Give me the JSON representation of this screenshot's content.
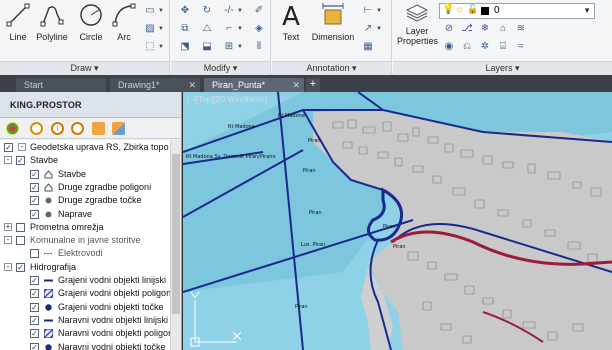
{
  "ribbon": {
    "draw": {
      "title": "Draw",
      "tools": [
        {
          "label": "Line",
          "icon": "line-icon"
        },
        {
          "label": "Polyline",
          "icon": "polyline-icon"
        },
        {
          "label": "Circle",
          "icon": "circle-icon"
        },
        {
          "label": "Arc",
          "icon": "arc-icon"
        }
      ]
    },
    "modify": {
      "title": "Modify"
    },
    "annotation": {
      "title": "Annotation",
      "tools": [
        {
          "label": "Text",
          "icon": "text-icon"
        },
        {
          "label": "Dimension",
          "icon": "dimension-icon"
        }
      ]
    },
    "layers": {
      "title": "Layers",
      "properties_label_1": "Layer",
      "properties_label_2": "Properties",
      "current_layer": "0"
    }
  },
  "tabs": [
    {
      "label": "Start",
      "active": false
    },
    {
      "label": "Drawing1*",
      "active": false
    },
    {
      "label": "Piran_Punta*",
      "active": true
    }
  ],
  "palette": {
    "title": "KING.PROSTOR",
    "tree": [
      {
        "label": "Geodetska uprava RS, Zbirka topo",
        "level": 0,
        "checked": true,
        "expander": "-"
      },
      {
        "label": "Stavbe",
        "level": 1,
        "checked": true,
        "expander": "-"
      },
      {
        "label": "Stavbe",
        "level": 2,
        "checked": true,
        "symbol": "house-icon"
      },
      {
        "label": "Druge zgradbe poligoni",
        "level": 2,
        "checked": true,
        "symbol": "house-icon"
      },
      {
        "label": "Druge zgradbe točke",
        "level": 2,
        "checked": true,
        "symbol": "dot-icon"
      },
      {
        "label": "Naprave",
        "level": 2,
        "checked": true,
        "symbol": "dot-icon"
      },
      {
        "label": "Prometna omrežja",
        "level": 1,
        "checked": false,
        "expander": "+"
      },
      {
        "label": "Komunalne in javne storitve",
        "level": 1,
        "checked": false,
        "expander": "-",
        "dim": true
      },
      {
        "label": "Elektrovodi",
        "level": 2,
        "checked": false,
        "symbol": "dashed-line-icon",
        "dim": true
      },
      {
        "label": "Hidrografija",
        "level": 1,
        "checked": true,
        "expander": "-"
      },
      {
        "label": "Grajeni vodni objekti linijski",
        "level": 2,
        "checked": true,
        "symbol": "blue-line-icon"
      },
      {
        "label": "Grajeni vodni objekti poligoni",
        "level": 2,
        "checked": true,
        "symbol": "hatch-icon"
      },
      {
        "label": "Grajeni vodni objekti točke",
        "level": 2,
        "checked": true,
        "symbol": "blue-dot-icon"
      },
      {
        "label": "Naravni vodni objekti linijski",
        "level": 2,
        "checked": true,
        "symbol": "blue-line-icon"
      },
      {
        "label": "Naravni vodni objekti poligoni",
        "level": 2,
        "checked": true,
        "symbol": "hatch-icon"
      },
      {
        "label": "Naravni vodni objekti točke",
        "level": 2,
        "checked": true,
        "symbol": "blue-dot-icon"
      }
    ]
  },
  "viewport": {
    "label": "[–][Top][2D Wireframe]",
    "map_labels": [
      "Rt Madona",
      "Rt Madona",
      "Piran",
      "Rt Madona Sv. Dominik Piran/Pirano",
      "Piran",
      "Piran",
      "Lus. Piran",
      "Piran",
      "Piran",
      "Piran"
    ]
  },
  "colors": {
    "sea": "#8fd1e6",
    "land": "#c9c9c9",
    "boundary": "#1a2a8c",
    "road": "#9c1b3a"
  }
}
